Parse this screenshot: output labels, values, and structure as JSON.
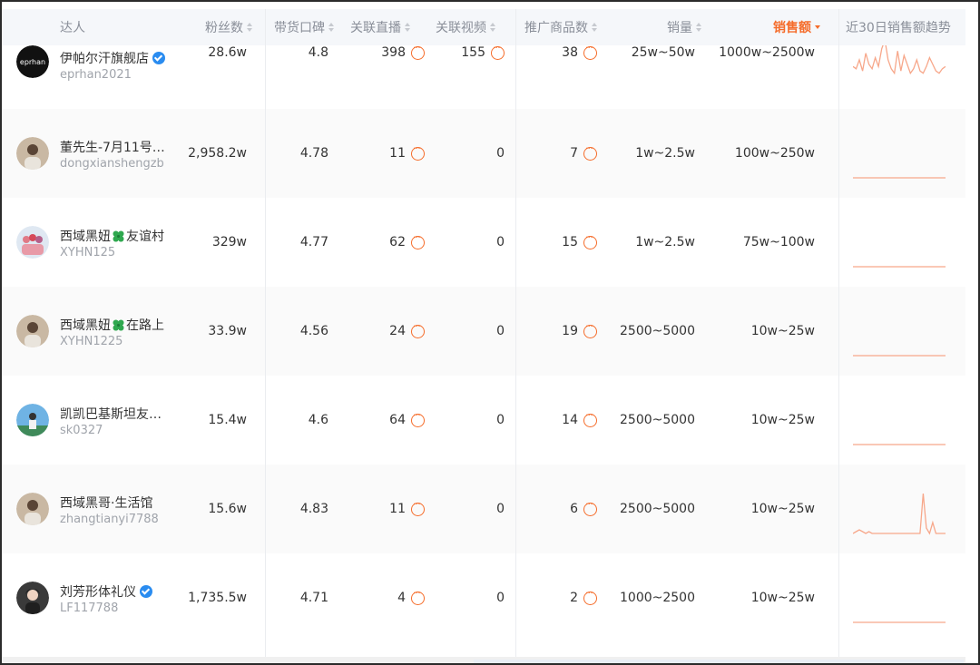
{
  "columns": [
    {
      "key": "influencer",
      "label": "达人",
      "sortable": false
    },
    {
      "key": "fans",
      "label": "粉丝数",
      "sortable": true
    },
    {
      "key": "rating",
      "label": "带货口碑",
      "sortable": true
    },
    {
      "key": "live",
      "label": "关联直播",
      "sortable": true
    },
    {
      "key": "video",
      "label": "关联视频",
      "sortable": true
    },
    {
      "key": "products",
      "label": "推广商品数",
      "sortable": true
    },
    {
      "key": "sales",
      "label": "销量",
      "sortable": true
    },
    {
      "key": "revenue",
      "label": "销售额",
      "sortable": true,
      "active": true
    },
    {
      "key": "trend",
      "label": "近30日销售额趋势",
      "sortable": false
    }
  ],
  "accent_color": "#f56c2a",
  "rows": [
    {
      "name": "伊帕尔汗旗舰店",
      "handle": "eprhan2021",
      "verified": true,
      "avatar": "eprhan-logo",
      "fans": "28.6w",
      "rating": "4.8",
      "live": "398",
      "video": "155",
      "products": "38",
      "sales": "25w~50w",
      "revenue": "1000w~2500w",
      "trend": [
        6,
        5,
        9,
        4,
        12,
        7,
        5,
        10,
        6,
        14,
        18,
        9,
        5,
        3,
        13,
        4,
        11,
        7,
        3,
        5,
        9,
        4,
        3,
        6,
        10,
        7,
        4,
        3,
        5,
        6
      ],
      "avatar_text": "eprhan"
    },
    {
      "name": "董先生-7月11号…",
      "handle": "dongxianshengzb",
      "verified": false,
      "avatar": "person-avatar",
      "fans": "2,958.2w",
      "rating": "4.78",
      "live": "11",
      "video": "0",
      "products": "7",
      "sales": "1w~2.5w",
      "revenue": "100w~250w",
      "trend": [
        0,
        0,
        0,
        0,
        0,
        0,
        0,
        0,
        0,
        0,
        0,
        0,
        0,
        0,
        0,
        0,
        0,
        0,
        0,
        0,
        0,
        0,
        0,
        0,
        0,
        0,
        0,
        0,
        0,
        0
      ]
    },
    {
      "name_parts": [
        "西域黑妞",
        "友谊村"
      ],
      "name": "西域黑妞友谊村",
      "handle": "XYHN125",
      "verified": false,
      "avatar": "group-avatar",
      "fans": "329w",
      "rating": "4.77",
      "live": "62",
      "video": "0",
      "products": "15",
      "sales": "1w~2.5w",
      "revenue": "75w~100w",
      "trend": [
        0,
        0,
        0,
        0,
        0,
        0,
        0,
        0,
        0,
        0,
        0,
        0,
        0,
        0,
        0,
        0,
        0,
        0,
        0,
        0,
        0,
        0,
        0,
        0,
        0,
        0,
        0,
        0,
        0,
        0
      ]
    },
    {
      "name_parts": [
        "西域黑妞",
        "在路上"
      ],
      "name": "西域黑妞在路上",
      "handle": "XYHN1225",
      "verified": false,
      "avatar": "person-avatar",
      "fans": "33.9w",
      "rating": "4.56",
      "live": "24",
      "video": "0",
      "products": "19",
      "sales": "2500~5000",
      "revenue": "10w~25w",
      "trend": [
        0,
        0,
        0,
        0,
        0,
        0,
        0,
        0,
        0,
        0,
        0,
        0,
        0,
        0,
        0,
        0,
        0,
        0,
        0,
        0,
        0,
        0,
        0,
        0,
        0,
        0,
        0,
        0,
        0,
        0
      ]
    },
    {
      "name": "凯凯巴基斯坦友…",
      "handle": "sk0327",
      "verified": false,
      "avatar": "outdoor-avatar",
      "fans": "15.4w",
      "rating": "4.6",
      "live": "64",
      "video": "0",
      "products": "14",
      "sales": "2500~5000",
      "revenue": "10w~25w",
      "trend": [
        0,
        0,
        0,
        0,
        0,
        0,
        0,
        0,
        0,
        0,
        0,
        0,
        0,
        0,
        0,
        0,
        0,
        0,
        0,
        0,
        0,
        0,
        0,
        0,
        0,
        0,
        0,
        0,
        0,
        0
      ]
    },
    {
      "name": "西域黑哥·生活馆",
      "handle": "zhangtianyi7788",
      "verified": false,
      "avatar": "person-avatar",
      "fans": "15.6w",
      "rating": "4.83",
      "live": "11",
      "video": "0",
      "products": "6",
      "sales": "2500~5000",
      "revenue": "10w~25w",
      "trend": [
        0,
        1,
        2,
        1,
        0,
        1,
        0,
        0,
        0,
        0,
        0,
        0,
        0,
        0,
        0,
        0,
        0,
        0,
        0,
        0,
        0,
        0,
        22,
        3,
        0,
        6,
        0,
        0,
        0,
        0
      ]
    },
    {
      "name": "刘芳形体礼仪",
      "handle": "LF117788",
      "verified": true,
      "avatar": "woman-avatar",
      "fans": "1,735.5w",
      "rating": "4.71",
      "live": "4",
      "video": "0",
      "products": "2",
      "sales": "1000~2500",
      "revenue": "10w~25w",
      "trend": [
        0,
        0,
        0,
        0,
        0,
        0,
        0,
        0,
        0,
        0,
        0,
        0,
        0,
        0,
        0,
        0,
        0,
        0,
        0,
        0,
        0,
        0,
        0,
        0,
        0,
        0,
        0,
        0,
        0,
        0
      ]
    }
  ]
}
